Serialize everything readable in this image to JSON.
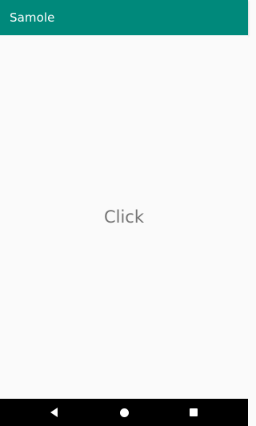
{
  "app_bar": {
    "title": "Samole",
    "color": "#00897b"
  },
  "main": {
    "click_label": "Click"
  },
  "nav_bar": {
    "back_icon": "back-triangle-icon",
    "home_icon": "home-circle-icon",
    "recents_icon": "recents-square-icon"
  }
}
